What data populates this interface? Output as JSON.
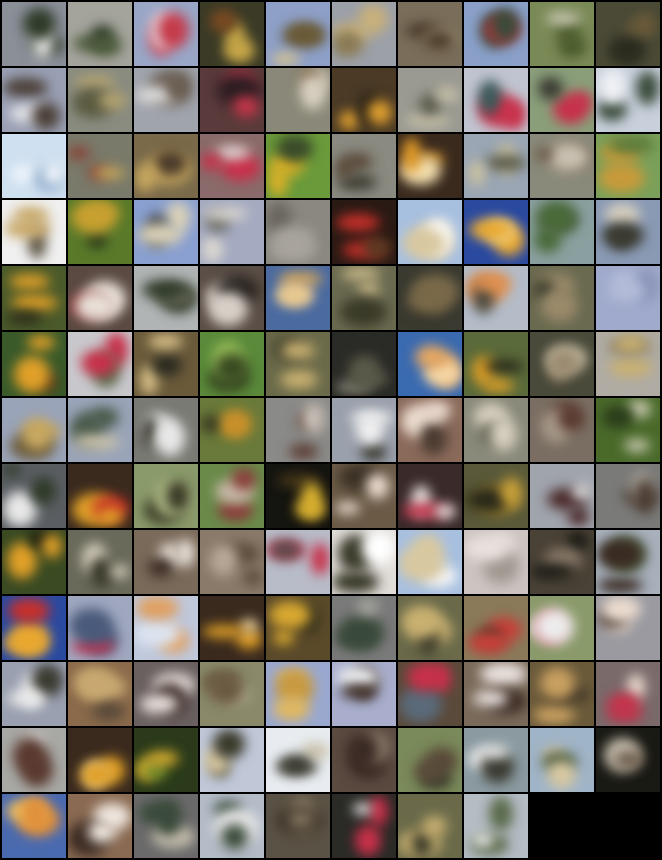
{
  "grid": {
    "columns": 10,
    "rows": 13,
    "tile_count": 128,
    "border_color": "#000000",
    "tiles": [
      {
        "bg": "#8a8f98",
        "fg": "#2e3a28",
        "accent": "#e6e6e6",
        "icon": "sample-tile"
      },
      {
        "bg": "#a4a49c",
        "fg": "#4c5a3a",
        "accent": "#2c3a24",
        "icon": "sample-tile"
      },
      {
        "bg": "#9aa6c6",
        "fg": "#c43a4a",
        "accent": "#e8e8ee",
        "icon": "sample-tile"
      },
      {
        "bg": "#3a3a26",
        "fg": "#c8a848",
        "accent": "#7a4a22",
        "icon": "sample-tile"
      },
      {
        "bg": "#8ea0c8",
        "fg": "#6a5a36",
        "accent": "#d8c48a",
        "icon": "sample-tile"
      },
      {
        "bg": "#9ca0a8",
        "fg": "#c8b07a",
        "accent": "#8a7a52",
        "icon": "sample-tile"
      },
      {
        "bg": "#7a6e5a",
        "fg": "#4a3a2a",
        "accent": "#a89a7a",
        "icon": "sample-tile"
      },
      {
        "bg": "#8aa0c8",
        "fg": "#3a4a3a",
        "accent": "#c4363e",
        "icon": "sample-tile"
      },
      {
        "bg": "#7a8a56",
        "fg": "#4a5a2a",
        "accent": "#c8c8b0",
        "icon": "sample-tile"
      },
      {
        "bg": "#4a4a36",
        "fg": "#6a5a3a",
        "accent": "#2a2a1e",
        "icon": "sample-tile"
      },
      {
        "bg": "#9aa0b4",
        "fg": "#4a3e36",
        "accent": "#e8e8ec",
        "icon": "sample-tile"
      },
      {
        "bg": "#8a8c80",
        "fg": "#b8a670",
        "accent": "#5a5a40",
        "icon": "sample-tile"
      },
      {
        "bg": "#a0a4ac",
        "fg": "#6a5e52",
        "accent": "#dcdcdc",
        "icon": "sample-tile"
      },
      {
        "bg": "#5a3a3a",
        "fg": "#c4364a",
        "accent": "#2a1e22",
        "icon": "sample-tile"
      },
      {
        "bg": "#8a8878",
        "fg": "#d8d0c0",
        "accent": "#6a5030",
        "icon": "sample-tile"
      },
      {
        "bg": "#4a3a26",
        "fg": "#e0a030",
        "accent": "#1e1a14",
        "icon": "sample-tile"
      },
      {
        "bg": "#9a9a92",
        "fg": "#c8c0a8",
        "accent": "#5a5a4a",
        "icon": "sample-tile"
      },
      {
        "bg": "#c0c4d0",
        "fg": "#c8304a",
        "accent": "#3a5a5a",
        "icon": "sample-tile"
      },
      {
        "bg": "#8a9e7a",
        "fg": "#c8304a",
        "accent": "#3a3a32",
        "icon": "sample-tile"
      },
      {
        "bg": "#c8d0dc",
        "fg": "#3a4a3a",
        "accent": "#eef0f4",
        "icon": "sample-tile"
      },
      {
        "bg": "#cfe0f0",
        "fg": "#eef4fa",
        "accent": "#8aa8c8",
        "icon": "sample-tile"
      },
      {
        "bg": "#7a7a6a",
        "fg": "#8a3a30",
        "accent": "#c8a858",
        "icon": "sample-tile"
      },
      {
        "bg": "#7a6a4a",
        "fg": "#c8a860",
        "accent": "#4a3a2a",
        "icon": "sample-tile"
      },
      {
        "bg": "#8a6a6a",
        "fg": "#c8304a",
        "accent": "#e6e0dc",
        "icon": "sample-tile"
      },
      {
        "bg": "#6a9a3a",
        "fg": "#d8b028",
        "accent": "#3a4a2a",
        "icon": "sample-tile"
      },
      {
        "bg": "#8a8a80",
        "fg": "#5a4a3a",
        "accent": "#3a3a30",
        "icon": "sample-tile"
      },
      {
        "bg": "#3a2a1e",
        "fg": "#e09a28",
        "accent": "#f4e0b0",
        "icon": "sample-tile"
      },
      {
        "bg": "#9aa6b4",
        "fg": "#c8c0a0",
        "accent": "#5a5a4a",
        "icon": "sample-tile"
      },
      {
        "bg": "#8a8a7a",
        "fg": "#6a5a4a",
        "accent": "#c8c0b0",
        "icon": "sample-tile"
      },
      {
        "bg": "#7aa05a",
        "fg": "#c89a3a",
        "accent": "#5a7a3a",
        "icon": "sample-tile"
      },
      {
        "bg": "#f0f0f0",
        "fg": "#c8a868",
        "accent": "#5a5040",
        "icon": "sample-tile"
      },
      {
        "bg": "#5a7a2a",
        "fg": "#c8a030",
        "accent": "#2a3a1a",
        "icon": "sample-tile"
      },
      {
        "bg": "#8aa0d0",
        "fg": "#d8d0b8",
        "accent": "#3a3a34",
        "icon": "sample-tile"
      },
      {
        "bg": "#a4aac0",
        "fg": "#dcd8d0",
        "accent": "#6a6a60",
        "icon": "sample-tile"
      },
      {
        "bg": "#8a8880",
        "fg": "#a8a49c",
        "accent": "#6a665e",
        "icon": "sample-tile"
      },
      {
        "bg": "#2a1a14",
        "fg": "#c8302a",
        "accent": "#5a3a22",
        "icon": "sample-tile"
      },
      {
        "bg": "#a8c0e0",
        "fg": "#d8c8a0",
        "accent": "#ffffff",
        "icon": "sample-tile"
      },
      {
        "bg": "#2a4aa0",
        "fg": "#e8a830",
        "accent": "#f4d890",
        "icon": "sample-tile"
      },
      {
        "bg": "#8aa0a0",
        "fg": "#4a6a3a",
        "accent": "#3a3a30",
        "icon": "sample-tile"
      },
      {
        "bg": "#8a9ab4",
        "fg": "#3a3a30",
        "accent": "#d8d0c0",
        "icon": "sample-tile"
      },
      {
        "bg": "#4a5a2a",
        "fg": "#e0a028",
        "accent": "#2a2a1a",
        "icon": "sample-tile"
      },
      {
        "bg": "#5a4a42",
        "fg": "#e8e0d8",
        "accent": "#8a3030",
        "icon": "sample-tile"
      },
      {
        "bg": "#b0b4b4",
        "fg": "#2e3a28",
        "accent": "#6a6a5a",
        "icon": "sample-tile"
      },
      {
        "bg": "#5a4e46",
        "fg": "#d8d0c8",
        "accent": "#2a2420",
        "icon": "sample-tile"
      },
      {
        "bg": "#4a6aa0",
        "fg": "#e8c890",
        "accent": "#c8a060",
        "icon": "sample-tile"
      },
      {
        "bg": "#6a6a50",
        "fg": "#c8b888",
        "accent": "#3a3a28",
        "icon": "sample-tile"
      },
      {
        "bg": "#3a3a30",
        "fg": "#7a6a4a",
        "accent": "#1a1a14",
        "icon": "sample-tile"
      },
      {
        "bg": "#b4bcc8",
        "fg": "#e09050",
        "accent": "#4a4a40",
        "icon": "sample-tile"
      },
      {
        "bg": "#6a6a50",
        "fg": "#9a8a6a",
        "accent": "#3a3a2a",
        "icon": "sample-tile"
      },
      {
        "bg": "#a0aacc",
        "fg": "#b4bcd8",
        "accent": "#8894b8",
        "icon": "sample-tile"
      },
      {
        "bg": "#3a5a2a",
        "fg": "#e0a028",
        "accent": "#5a3a1a",
        "icon": "sample-tile"
      },
      {
        "bg": "#c8c8cc",
        "fg": "#c8304a",
        "accent": "#5a6a4a",
        "icon": "sample-tile"
      },
      {
        "bg": "#6a5a3a",
        "fg": "#d8c088",
        "accent": "#2a2a20",
        "icon": "sample-tile"
      },
      {
        "bg": "#5a8a3a",
        "fg": "#3a4a22",
        "accent": "#9ac05a",
        "icon": "sample-tile"
      },
      {
        "bg": "#6a6a4a",
        "fg": "#c8b070",
        "accent": "#3a3a2a",
        "icon": "sample-tile"
      },
      {
        "bg": "#2a2a26",
        "fg": "#5a5a4a",
        "accent": "#8a8a7a",
        "icon": "sample-tile"
      },
      {
        "bg": "#3a6ab0",
        "fg": "#e8a860",
        "accent": "#f4d8a8",
        "icon": "sample-tile"
      },
      {
        "bg": "#5a6a3a",
        "fg": "#e0a028",
        "accent": "#2a2a1a",
        "icon": "sample-tile"
      },
      {
        "bg": "#4a4a3a",
        "fg": "#9a8a70",
        "accent": "#c8c0a8",
        "icon": "sample-tile"
      },
      {
        "bg": "#b0aca4",
        "fg": "#c8b070",
        "accent": "#8a7a5a",
        "icon": "sample-tile"
      },
      {
        "bg": "#9aa4b8",
        "fg": "#c8a860",
        "accent": "#6a5a3a",
        "icon": "sample-tile"
      },
      {
        "bg": "#9aa4b8",
        "fg": "#4a5a4a",
        "accent": "#c8c0a8",
        "icon": "sample-tile"
      },
      {
        "bg": "#7a7a74",
        "fg": "#e8e8e8",
        "accent": "#3a3a30",
        "icon": "sample-tile"
      },
      {
        "bg": "#6a7a3a",
        "fg": "#c8902a",
        "accent": "#3a3a22",
        "icon": "sample-tile"
      },
      {
        "bg": "#8a8a88",
        "fg": "#5a3a30",
        "accent": "#c8c0b8",
        "icon": "sample-tile"
      },
      {
        "bg": "#9aa0ac",
        "fg": "#f0f0f0",
        "accent": "#3a3a30",
        "icon": "sample-tile"
      },
      {
        "bg": "#8a6a5a",
        "fg": "#ecdcd0",
        "accent": "#4a3a30",
        "icon": "sample-tile"
      },
      {
        "bg": "#8a8a7a",
        "fg": "#d8d0c0",
        "accent": "#5a5a4a",
        "icon": "sample-tile"
      },
      {
        "bg": "#7a6e62",
        "fg": "#5a3a30",
        "accent": "#a89a8a",
        "icon": "sample-tile"
      },
      {
        "bg": "#4a6a2a",
        "fg": "#c8c8b0",
        "accent": "#2a3a1a",
        "icon": "sample-tile"
      },
      {
        "bg": "#5a5e62",
        "fg": "#2e3a28",
        "accent": "#e8e8e8",
        "icon": "sample-tile"
      },
      {
        "bg": "#3a2a1e",
        "fg": "#e0a028",
        "accent": "#c83028",
        "icon": "sample-tile"
      },
      {
        "bg": "#8a9a6a",
        "fg": "#3a3a26",
        "accent": "#b4c08a",
        "icon": "sample-tile"
      },
      {
        "bg": "#6a8a4a",
        "fg": "#8a3a3a",
        "accent": "#c8b8a8",
        "icon": "sample-tile"
      },
      {
        "bg": "#141410",
        "fg": "#d8b030",
        "accent": "#4a3a1a",
        "icon": "sample-tile"
      },
      {
        "bg": "#6a5a46",
        "fg": "#ecdcd0",
        "accent": "#3a3024",
        "icon": "sample-tile"
      },
      {
        "bg": "#3a2a2a",
        "fg": "#e8e0dc",
        "accent": "#c8304a",
        "icon": "sample-tile"
      },
      {
        "bg": "#5a5a3a",
        "fg": "#c8a038",
        "accent": "#2a2a1a",
        "icon": "sample-tile"
      },
      {
        "bg": "#a0a4ac",
        "fg": "#4a2a2a",
        "accent": "#dcdcdc",
        "icon": "sample-tile"
      },
      {
        "bg": "#7a7a78",
        "fg": "#4a3a30",
        "accent": "#a8a49c",
        "icon": "sample-tile"
      },
      {
        "bg": "#3a4a22",
        "fg": "#e0a028",
        "accent": "#1a1a10",
        "icon": "sample-tile"
      },
      {
        "bg": "#6a6a5a",
        "fg": "#d8d0c0",
        "accent": "#3a3a2a",
        "icon": "sample-tile"
      },
      {
        "bg": "#7a6a5a",
        "fg": "#e8e0d8",
        "accent": "#3a2a22",
        "icon": "sample-tile"
      },
      {
        "bg": "#8a7a6a",
        "fg": "#5a4a3a",
        "accent": "#b8a898",
        "icon": "sample-tile"
      },
      {
        "bg": "#b8bcc8",
        "fg": "#c8304a",
        "accent": "#5a4a4a",
        "icon": "sample-tile"
      },
      {
        "bg": "#e0dcd8",
        "fg": "#3a3a2a",
        "accent": "#ffffff",
        "icon": "sample-tile"
      },
      {
        "bg": "#a8c0e0",
        "fg": "#d8c8a0",
        "accent": "#f8f8f8",
        "icon": "sample-tile"
      },
      {
        "bg": "#ccc4c0",
        "fg": "#e8e0dc",
        "accent": "#a09890",
        "icon": "sample-tile"
      },
      {
        "bg": "#4a4236",
        "fg": "#1a1a14",
        "accent": "#8a7a6a",
        "icon": "sample-tile"
      },
      {
        "bg": "#a8b0bc",
        "fg": "#3a2a22",
        "accent": "#4a5a3a",
        "icon": "sample-tile"
      },
      {
        "bg": "#2a4aa0",
        "fg": "#e8a830",
        "accent": "#c8302a",
        "icon": "sample-tile"
      },
      {
        "bg": "#a0a8c0",
        "fg": "#4a5a7a",
        "accent": "#c8304a",
        "icon": "sample-tile"
      },
      {
        "bg": "#c0c8dc",
        "fg": "#e0a060",
        "accent": "#dce4f0",
        "icon": "sample-tile"
      },
      {
        "bg": "#3a2a1e",
        "fg": "#e0a028",
        "accent": "#f0d8a8",
        "icon": "sample-tile"
      },
      {
        "bg": "#5a4a2a",
        "fg": "#d8a830",
        "accent": "#2a2a1a",
        "icon": "sample-tile"
      },
      {
        "bg": "#7a7a7a",
        "fg": "#3a4a3a",
        "accent": "#a8a8a0",
        "icon": "sample-tile"
      },
      {
        "bg": "#6a6a4a",
        "fg": "#c8b070",
        "accent": "#3a3a2a",
        "icon": "sample-tile"
      },
      {
        "bg": "#8a7a5a",
        "fg": "#c8403a",
        "accent": "#3a3022",
        "icon": "sample-tile"
      },
      {
        "bg": "#8a9a6a",
        "fg": "#ececec",
        "accent": "#c8304a",
        "icon": "sample-tile"
      },
      {
        "bg": "#9a9aa0",
        "fg": "#ecdcd0",
        "accent": "#4a3a30",
        "icon": "sample-tile"
      },
      {
        "bg": "#9aa0b0",
        "fg": "#ececec",
        "accent": "#3a3a30",
        "icon": "sample-tile"
      },
      {
        "bg": "#8a6a4a",
        "fg": "#c8a870",
        "accent": "#5a4a3a",
        "icon": "sample-tile"
      },
      {
        "bg": "#6a6060",
        "fg": "#e8e0dc",
        "accent": "#3a2a24",
        "icon": "sample-tile"
      },
      {
        "bg": "#8a8a6a",
        "fg": "#6a5a42",
        "accent": "#b4ac94",
        "icon": "sample-tile"
      },
      {
        "bg": "#9aa8d0",
        "fg": "#e0b860",
        "accent": "#c89a40",
        "icon": "sample-tile"
      },
      {
        "bg": "#a8aecc",
        "fg": "#3a2a22",
        "accent": "#eef0f4",
        "icon": "sample-tile"
      },
      {
        "bg": "#5a4a3a",
        "fg": "#c8304a",
        "accent": "#5a6a7a",
        "icon": "sample-tile"
      },
      {
        "bg": "#7a6a5a",
        "fg": "#e8e0dc",
        "accent": "#3a2a22",
        "icon": "sample-tile"
      },
      {
        "bg": "#6a5a3a",
        "fg": "#c8a060",
        "accent": "#3a3024",
        "icon": "sample-tile"
      },
      {
        "bg": "#7a6a6a",
        "fg": "#c8304a",
        "accent": "#ecdcd0",
        "icon": "sample-tile"
      },
      {
        "bg": "#a8a8a4",
        "fg": "#5a3a30",
        "accent": "#f0f0f0",
        "icon": "sample-tile"
      },
      {
        "bg": "#3a2a1e",
        "fg": "#e0a028",
        "accent": "#f4e0b0",
        "icon": "sample-tile"
      },
      {
        "bg": "#2a3a1a",
        "fg": "#d8b030",
        "accent": "#6a8a2a",
        "icon": "sample-tile"
      },
      {
        "bg": "#c0c8d8",
        "fg": "#3a3a2a",
        "accent": "#d8c8a0",
        "icon": "sample-tile"
      },
      {
        "bg": "#e8ecf0",
        "fg": "#3a3a30",
        "accent": "#c8c0a8",
        "icon": "sample-tile"
      },
      {
        "bg": "#5a4a40",
        "fg": "#3a2a24",
        "accent": "#8a7a6a",
        "icon": "sample-tile"
      },
      {
        "bg": "#7a8a5a",
        "fg": "#5a4a3a",
        "accent": "#3a3a2a",
        "icon": "sample-tile"
      },
      {
        "bg": "#8a9aa0",
        "fg": "#ececec",
        "accent": "#3a3a30",
        "icon": "sample-tile"
      },
      {
        "bg": "#a0b4c8",
        "fg": "#d8c8a0",
        "accent": "#4a5a3a",
        "icon": "sample-tile"
      },
      {
        "bg": "#1a1a14",
        "fg": "#6a5a4a",
        "accent": "#c8c0b0",
        "icon": "sample-tile"
      },
      {
        "bg": "#4a6ab0",
        "fg": "#e0903a",
        "accent": "#f0c060",
        "icon": "sample-tile"
      },
      {
        "bg": "#8a6a52",
        "fg": "#f0e8e0",
        "accent": "#3a2a22",
        "icon": "sample-tile"
      },
      {
        "bg": "#6a6a6a",
        "fg": "#3a4a3a",
        "accent": "#c8c0b0",
        "icon": "sample-tile"
      },
      {
        "bg": "#b4bcc8",
        "fg": "#3a4a3a",
        "accent": "#e8e8e8",
        "icon": "sample-tile"
      },
      {
        "bg": "#5a5244",
        "fg": "#8a7a62",
        "accent": "#3a3228",
        "icon": "sample-tile"
      },
      {
        "bg": "#2a2a26",
        "fg": "#c8304a",
        "accent": "#ececec",
        "icon": "sample-tile"
      },
      {
        "bg": "#6a6a4a",
        "fg": "#c8b070",
        "accent": "#3a3a2a",
        "icon": "sample-tile"
      },
      {
        "bg": "#b4bcc4",
        "fg": "#5a6a4a",
        "accent": "#ececec",
        "icon": "sample-tile"
      }
    ]
  }
}
